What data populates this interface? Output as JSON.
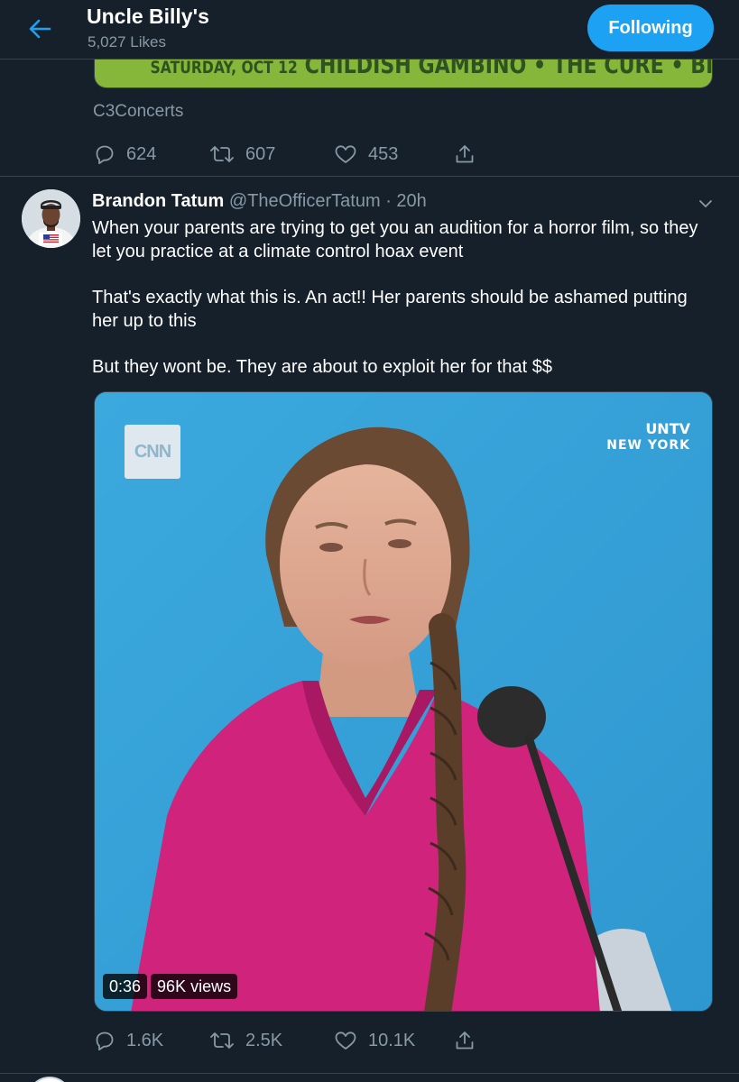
{
  "header": {
    "title": "Uncle Billy's",
    "subtitle": "5,027 Likes",
    "follow_label": "Following"
  },
  "prev_tweet": {
    "banner_text_date": "SATURDAY, OCT 12",
    "banner_text_acts": "CHILDISH GAMBINO  •  THE CURE  •  BILLIE EILISH",
    "source": "C3Concerts",
    "replies": "624",
    "retweets": "607",
    "likes": "453"
  },
  "tweet": {
    "author_name": "Brandon Tatum",
    "author_handle": "@TheOfficerTatum",
    "separator": "·",
    "time": "20h",
    "paragraphs": [
      "When your parents are trying to get you an audition for a horror film, so they let you practice at a climate control hoax event",
      "That's exactly what this is. An act!! Her parents should be ashamed putting her up to this",
      "But they wont be. They are about to exploit her for that $$"
    ],
    "video": {
      "logo_text": "CNN",
      "overlay_line1": "UNTV",
      "overlay_line2": "NEW YORK",
      "duration": "0:36",
      "views": "96K views"
    },
    "replies": "1.6K",
    "retweets": "2.5K",
    "likes": "10.1K"
  },
  "colors": {
    "background": "#15202b",
    "accent": "#1da1f2",
    "secondary_text": "#8899a6",
    "divider": "#38444d"
  },
  "icons": [
    "back-arrow-icon",
    "reply-icon",
    "retweet-icon",
    "like-icon",
    "share-icon",
    "chevron-down-icon"
  ]
}
